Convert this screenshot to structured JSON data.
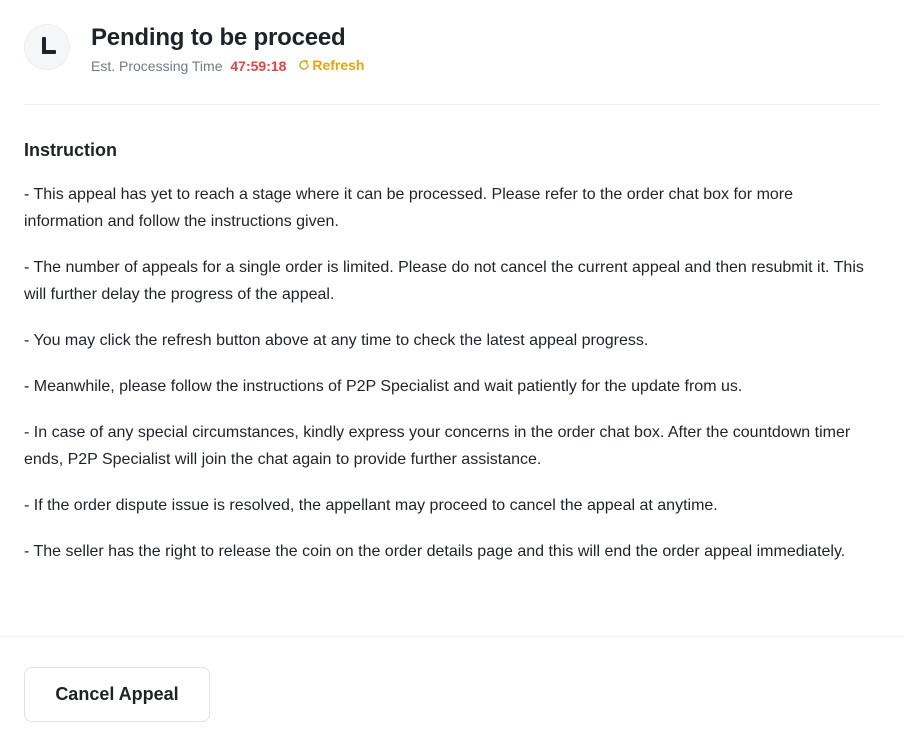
{
  "header": {
    "icon": "clock-icon",
    "title": "Pending to be proceed",
    "est_label": "Est. Processing Time",
    "countdown": "47:59:18",
    "refresh_label": "Refresh",
    "refresh_icon": "refresh-icon"
  },
  "instruction": {
    "title": "Instruction",
    "items": [
      "- This appeal has yet to reach a stage where it can be processed. Please refer to the order chat box for more information and follow the instructions given.",
      "- The number of appeals for a single order is limited. Please do not cancel the current appeal and then resubmit it. This will further delay the progress of the appeal.",
      "- You may click the refresh button above at any time to check the latest appeal progress.",
      "- Meanwhile, please follow the instructions of P2P Specialist and wait patiently for the update from us.",
      "- In case of any special circumstances, kindly express your concerns in the order chat box. After the countdown timer ends, P2P Specialist will join the chat again to provide further assistance.",
      "- If the order dispute issue is resolved, the appellant may proceed to cancel the appeal at anytime.",
      "- The seller has the right to release the coin on the order details page and this will end the order appeal immediately."
    ]
  },
  "actions": {
    "cancel_label": "Cancel Appeal"
  },
  "colors": {
    "countdown": "#e84142",
    "refresh": "#e8a30f",
    "text": "#1e2329",
    "muted": "#707a8a"
  }
}
